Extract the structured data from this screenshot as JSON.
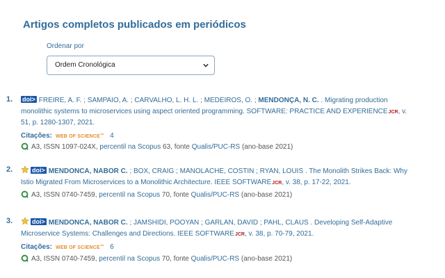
{
  "page_title": "Artigos completos publicados em periódicos",
  "sort": {
    "label": "Ordenar por",
    "selected": "Ordem Cronológica"
  },
  "colors": {
    "primary": "#326c99",
    "doi": "#1b59a8",
    "jcr": "#b31b1b",
    "wos": "#e48b2a",
    "star": "#f2c23a"
  },
  "articles": [
    {
      "number": "1.",
      "doi": "doi>",
      "line1_authors": "FREIRE, A. F. ; SAMPAIO, A. ; CARVALHO, L. H. L. ; MEDEIROS, O. ; ",
      "line1_bold": "MENDONÇA, N. C.",
      "line1_rest": ". Migrating production",
      "line2_text": "monolithic systems to microservices using aspect oriented programming. SOFTWARE: PRACTICE AND EXPERIENCE",
      "line2_jcr": "JCR",
      "line2_rest": ", v.",
      "line3_text": "51, p. 1280-1307, 2021.",
      "citations_label": "Citações:",
      "wos_label": "WEB OF SCIENCE",
      "wos_tm": "™",
      "citations_count": "4",
      "qualis_prefix": "A3, ISSN 1097-024X, ",
      "qualis_link1": "percentil na Scopus",
      "qualis_mid": " 63, fonte ",
      "qualis_link2": "Qualis/PUC-RS",
      "qualis_suffix": " (ano-base 2021)"
    },
    {
      "number": "2.",
      "doi": "doi>",
      "line1_bold": "MENDONCA, NABOR C.",
      "line1_authors": "; BOX, CRAIG ; MANOLACHE, COSTIN ; RYAN, LOUIS . The Monolith Strikes Back: Why",
      "line2_text": "Istio Migrated From Microservices to a Monolithic Architecture. IEEE SOFTWARE",
      "line2_jcr": "JCR",
      "line2_rest": ", v. 38, p. 17-22, 2021.",
      "qualis_prefix": "A3, ISSN 0740-7459, ",
      "qualis_link1": "percentil na Scopus",
      "qualis_mid": " 70, fonte ",
      "qualis_link2": "Qualis/PUC-RS",
      "qualis_suffix": " (ano-base 2021)"
    },
    {
      "number": "3.",
      "doi": "doi>",
      "line1_bold": "MENDONCA, NABOR C.",
      "line1_authors": "; JAMSHIDI, POOYAN ; GARLAN, DAVID ; PAHL, CLAUS . Developing Self-Adaptive",
      "line2_text": "Microservice Systems: Challenges and Directions. IEEE SOFTWARE",
      "line2_jcr": "JCR",
      "line2_rest": ", v. 38, p. 70-79, 2021.",
      "citations_label": "Citações:",
      "wos_label": "WEB OF SCIENCE",
      "wos_tm": "™",
      "citations_count": "6",
      "qualis_prefix": "A3, ISSN 0740-7459, ",
      "qualis_link1": "percentil na Scopus",
      "qualis_mid": " 70, fonte ",
      "qualis_link2": "Qualis/PUC-RS",
      "qualis_suffix": " (ano-base 2021)"
    }
  ]
}
